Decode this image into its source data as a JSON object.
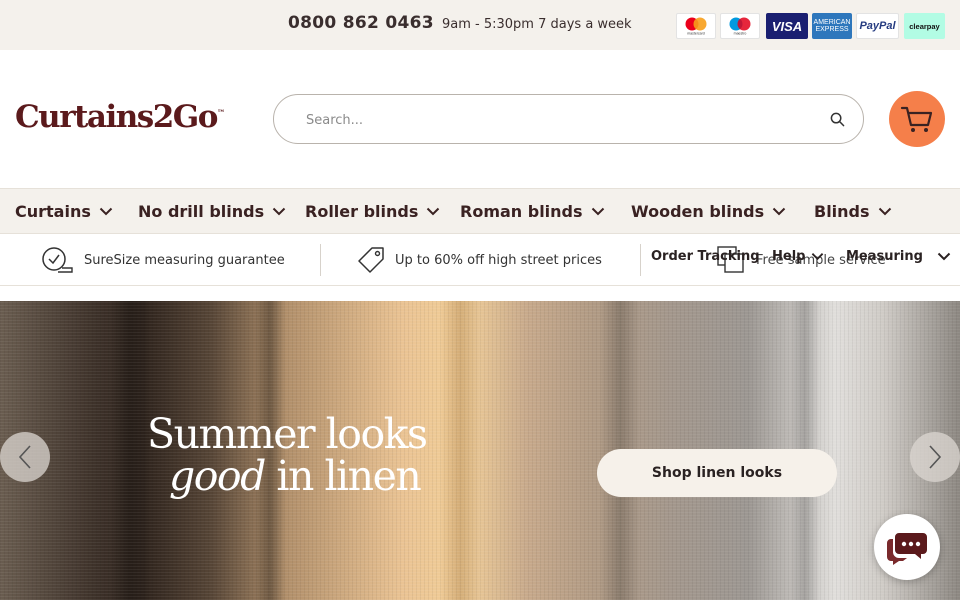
{
  "topbar": {
    "phone": "0800 862 0463",
    "hours": "9am - 5:30pm 7 days a week",
    "payments": [
      {
        "name": "Mastercard",
        "label": "mastercard"
      },
      {
        "name": "Maestro",
        "label": "maestro"
      },
      {
        "name": "Visa",
        "label": "VISA"
      },
      {
        "name": "American Express",
        "label": "AMERICAN EXPRESS"
      },
      {
        "name": "PayPal",
        "label": "PayPal"
      },
      {
        "name": "Clearpay",
        "label": "clearpay"
      }
    ]
  },
  "header": {
    "logo": "Curtains2Go",
    "logo_mark": "™",
    "search_placeholder": "Search...",
    "cart_color": "#f57f4a"
  },
  "nav": {
    "items": [
      "Curtains",
      "No drill blinds",
      "Roller blinds",
      "Roman blinds",
      "Wooden blinds",
      "Blinds"
    ]
  },
  "usp": {
    "items": [
      "SureSize measuring guarantee",
      "Up to 60% off high street prices",
      "Free sample service"
    ],
    "utility": [
      "Order Tracking",
      "Help",
      "Measuring"
    ]
  },
  "hero": {
    "title_line1": "Summer looks",
    "title_line2_em": "good",
    "title_line2_rest": " in linen",
    "cta": "Shop linen looks"
  },
  "colors": {
    "brand": "#5b1a1c",
    "accent": "#f57f4a",
    "topbar_bg": "#f4f1ec"
  }
}
